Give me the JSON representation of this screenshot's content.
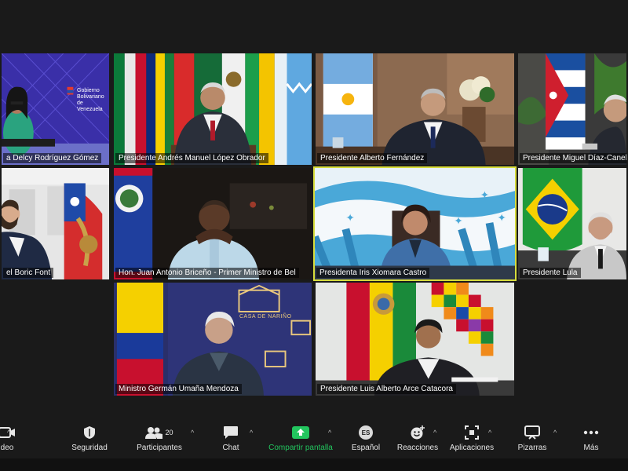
{
  "participants": [
    {
      "name": "a Delcy Rodríguez Gómez",
      "brand_line1": "Gobierno",
      "brand_line2": "Bolivariano",
      "brand_line3": "de Venezuela"
    },
    {
      "name": "Presidente Andrés Manuel López Obrador"
    },
    {
      "name": "Presidente Alberto Fernández"
    },
    {
      "name": "Presidente Miguel Díaz-Canel"
    },
    {
      "name": "el Boric Font"
    },
    {
      "name": "Hon. Juan Antonio Briceño - Primer Ministro de Bel"
    },
    {
      "name": "Presidenta Iris Xiomara Castro"
    },
    {
      "name": "Presidente Lula"
    },
    {
      "name": "Ministro Germán Umaña Mendoza",
      "brand": "CASA DE NARIÑO"
    },
    {
      "name": "Presidente Luis Alberto Arce Catacora"
    }
  ],
  "toolbar": {
    "items": [
      {
        "icon": "video-icon",
        "label": "deo"
      },
      {
        "icon": "shield-icon",
        "label": "Seguridad"
      },
      {
        "icon": "participants-icon",
        "label": "Participantes",
        "count": "20"
      },
      {
        "icon": "chat-icon",
        "label": "Chat"
      },
      {
        "icon": "share-screen-icon",
        "label": "Compartir pantalla"
      },
      {
        "icon": "language-icon",
        "label": "Español",
        "badge": "ES"
      },
      {
        "icon": "reactions-icon",
        "label": "Reacciones"
      },
      {
        "icon": "apps-icon",
        "label": "Aplicaciones"
      },
      {
        "icon": "whiteboard-icon",
        "label": "Pizarras"
      },
      {
        "icon": "more-icon",
        "label": "Más"
      }
    ]
  },
  "colors": {
    "background": "#1a1a1a",
    "active_speaker_border": "#d7dc3c",
    "share_accent": "#22c55e"
  }
}
